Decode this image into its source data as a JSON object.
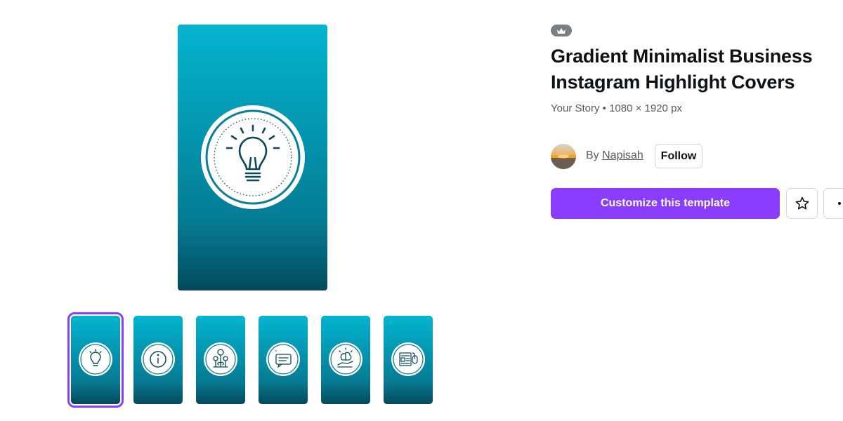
{
  "template": {
    "premium_icon": "crown-icon",
    "title": "Gradient Minimalist Business Instagram Highlight Covers",
    "subtitle": "Your Story • 1080 × 1920 px",
    "by_label": "By",
    "author": "Napisah",
    "follow_label": "Follow",
    "customize_label": "Customize this template"
  },
  "preview": {
    "icon": "lightbulb-icon"
  },
  "thumbnails": [
    {
      "icon": "lightbulb-icon",
      "selected": true
    },
    {
      "icon": "info-icon",
      "selected": false
    },
    {
      "icon": "money-plant-icon",
      "selected": false
    },
    {
      "icon": "quote-bubble-icon",
      "selected": false
    },
    {
      "icon": "brain-hand-icon",
      "selected": false
    },
    {
      "icon": "news-mouse-icon",
      "selected": false
    }
  ],
  "actions": {
    "favorite_icon": "star-icon",
    "more_icon": "more-icon"
  },
  "colors": {
    "accent": "#8b3dff",
    "gradient_top": "#05b4cf",
    "gradient_bottom": "#04495c",
    "icon_color": "#0b4a5c"
  }
}
